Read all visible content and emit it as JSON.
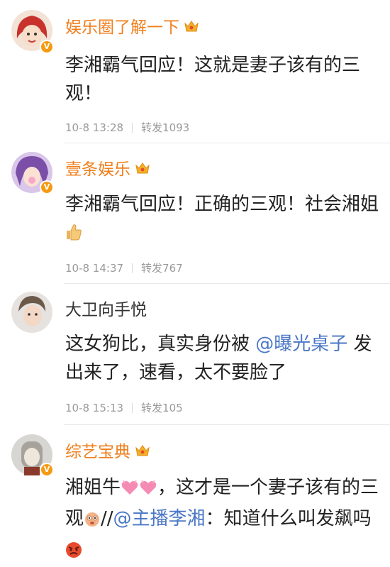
{
  "comments": [
    {
      "username": "娱乐圈了解一下",
      "text": "李湘霸气回应！这就是妻子该有的三观！",
      "time": "10-8 13:28",
      "repost": "转发1093"
    },
    {
      "username": "壹条娱乐",
      "text": "李湘霸气回应！正确的三观！社会湘姐",
      "time": "10-8 14:37",
      "repost": "转发767"
    },
    {
      "username": "大卫向手悦",
      "text_a": "这女狗比，真实身份被 ",
      "mention": "@曝光桌子",
      "text_b": " 发出来了，速看，太不要脸了",
      "time": "10-8 15:13",
      "repost": "转发105"
    },
    {
      "username": "综艺宝典",
      "text_a": "湘姐牛",
      "text_b": "，这才是一个妻子该有的三观",
      "text_c": "//",
      "mention": "@主播李湘",
      "text_d": "：知道什么叫发飙吗"
    }
  ],
  "icons": {
    "vip_badge": "crown-icon",
    "verified": "v-badge-icon",
    "thumbs_up": "thumbs-up-emoji",
    "hearts": "pink-heart-emoji",
    "face": "face-emoji",
    "angry": "angry-face-emoji"
  },
  "colors": {
    "vip_name": "#f07f1d",
    "mention": "#4a77c6",
    "meta": "#9a9a9a",
    "verified_badge": "#f59a12"
  }
}
